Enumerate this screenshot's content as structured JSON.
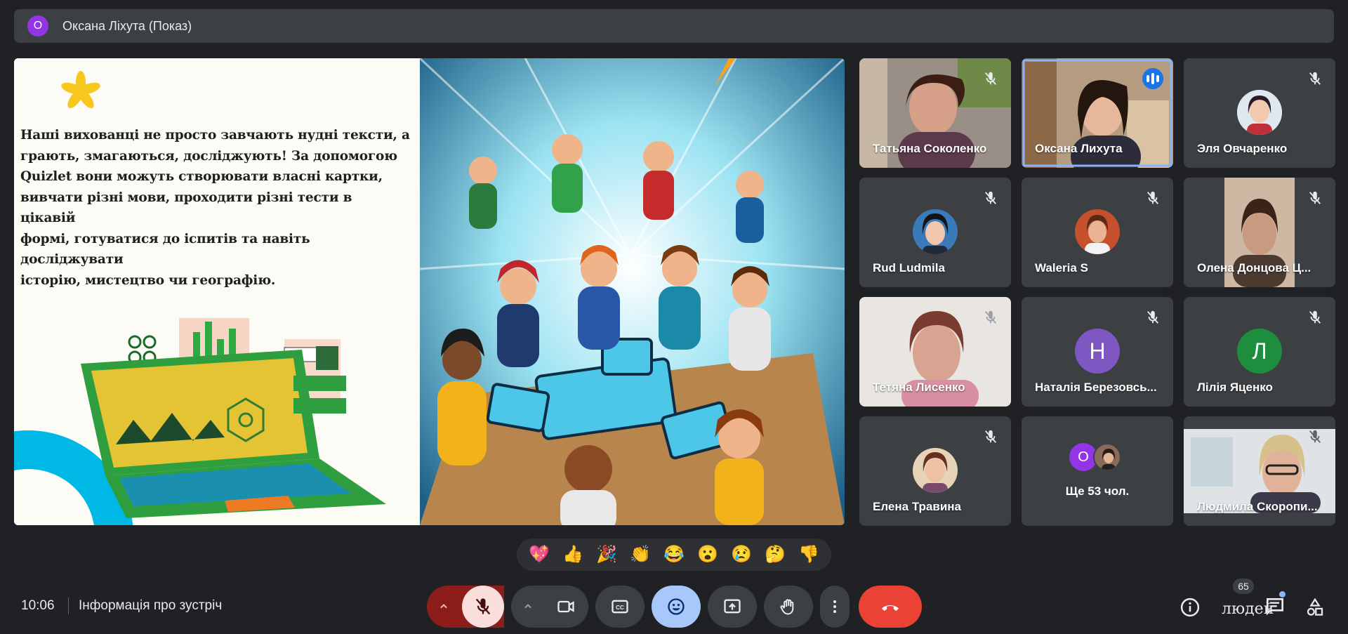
{
  "presenter": {
    "initial": "О",
    "name": "Оксана Ліхута (Показ)",
    "avatar_color": "#9334e6"
  },
  "slide": {
    "lines": [
      "Наші вихованці не просто завчають нудні тексти, а",
      "грають, змагаються, досліджують! За допомогою",
      "Quizlet вони можуть створювати власні картки,",
      "вивчати різні мови, проходити різні тести в цікавій",
      "формі, готуватися до іспитів та навіть досліджувати",
      "історію, мистецтво чи географію."
    ]
  },
  "participants": [
    {
      "name": "Татьяна Соколенко",
      "muted": true,
      "kind": "camera"
    },
    {
      "name": "Оксана Лихута",
      "muted": false,
      "speaking": true,
      "kind": "camera"
    },
    {
      "name": "Эля Овчаренко",
      "muted": true,
      "kind": "photo"
    },
    {
      "name": "Rud Ludmila",
      "muted": true,
      "kind": "photo"
    },
    {
      "name": "Waleria S",
      "muted": true,
      "kind": "photo"
    },
    {
      "name": "Олена Донцова Ц...",
      "muted": true,
      "kind": "camera"
    },
    {
      "name": "Тетяна Лисенко",
      "muted": true,
      "kind": "camera"
    },
    {
      "name": "Наталія Березовсь...",
      "muted": true,
      "kind": "letter",
      "initial": "Н",
      "color": "#7e57c2"
    },
    {
      "name": "Лілія Яценко",
      "muted": true,
      "kind": "letter",
      "initial": "Л",
      "color": "#1e8e3e"
    },
    {
      "name": "Елена Травина",
      "muted": true,
      "kind": "photo"
    },
    {
      "name": "Ще 53 чол.",
      "kind": "more",
      "initial": "О"
    },
    {
      "name": "Людмила Скоропи...",
      "muted": true,
      "kind": "camera"
    }
  ],
  "reactions": [
    "💖",
    "👍",
    "🎉",
    "👏",
    "😂",
    "😮",
    "😢",
    "🤔",
    "👎"
  ],
  "bottom": {
    "time": "10:06",
    "meeting_info": "Інформація про зустріч",
    "people_count": "65",
    "people_label": "людей"
  },
  "colors": {
    "hangup": "#ea4335",
    "emoji_active": "#a8c7fa",
    "mic_off": "#f9dedc",
    "accent": "#8ab4f8"
  },
  "icons": [
    "mic-off-icon",
    "camera-icon",
    "captions-icon",
    "emoji-icon",
    "present-icon",
    "raise-hand-icon",
    "more-options-icon",
    "hangup-icon",
    "info-icon",
    "chat-icon",
    "activities-icon"
  ]
}
